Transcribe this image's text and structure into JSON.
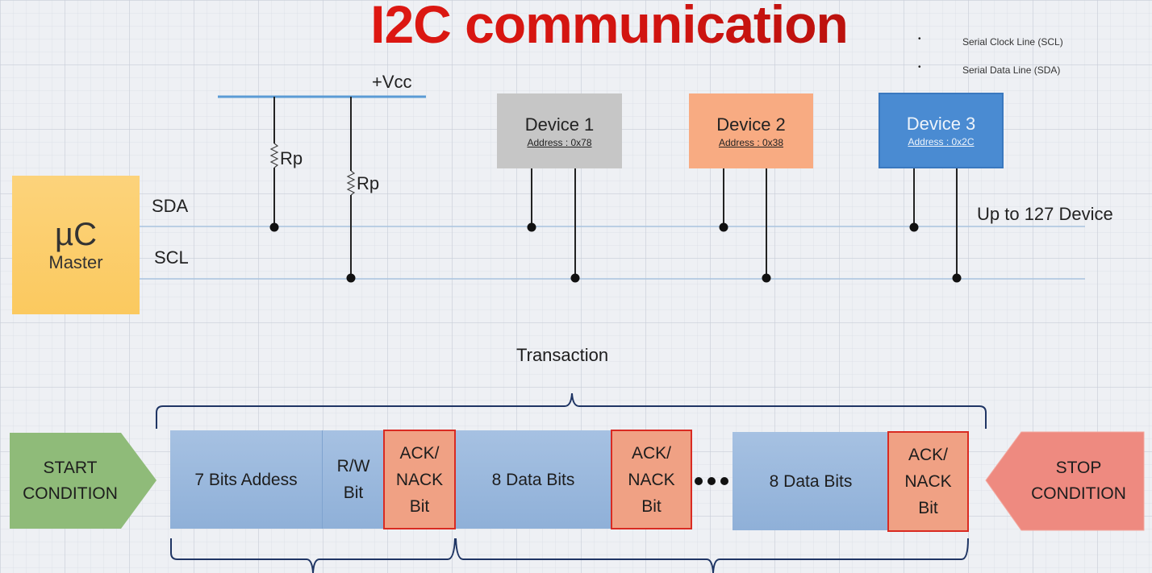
{
  "title": "I2C communication",
  "legend": [
    {
      "bullet": "•",
      "label": "Serial Clock Line (SCL)"
    },
    {
      "bullet": "•",
      "label": "Serial Data Line (SDA)"
    }
  ],
  "bus": {
    "vcc_label": "+Vcc",
    "pullups": [
      {
        "label": "Rp"
      },
      {
        "label": "Rp"
      }
    ],
    "sda_label": "SDA",
    "scl_label": "SCL",
    "capacity_note": "Up to 127 Device"
  },
  "master": {
    "symbol": "µC",
    "role": "Master",
    "color": "#fbcd6a"
  },
  "devices": [
    {
      "name": "Device 1",
      "address": "Address : 0x78",
      "color": "#c6c6c6"
    },
    {
      "name": "Device 2",
      "address": "Address : 0x38",
      "color": "#f8ab82"
    },
    {
      "name": "Device 3",
      "address": "Address : 0x2C",
      "color": "#4a8bd2"
    }
  ],
  "transaction": {
    "label": "Transaction",
    "start": {
      "line1": "START",
      "line2": "CONDITION",
      "color": "#8fbb79"
    },
    "stop": {
      "line1": "STOP",
      "line2": "CONDITION",
      "color": "#ee8a80"
    },
    "frames": [
      {
        "text": "7 Bits Addess"
      },
      {
        "line1": "R/W",
        "line2": "Bit"
      },
      {
        "line1": "ACK/",
        "line2": "NACK",
        "line3": "Bit"
      },
      {
        "text": "8 Data Bits"
      },
      {
        "line1": "ACK/",
        "line2": "NACK",
        "line3": "Bit"
      },
      {
        "text": "8 Data Bits"
      },
      {
        "line1": "ACK/",
        "line2": "NACK",
        "line3": "Bit"
      }
    ],
    "ellipsis": "•••"
  }
}
